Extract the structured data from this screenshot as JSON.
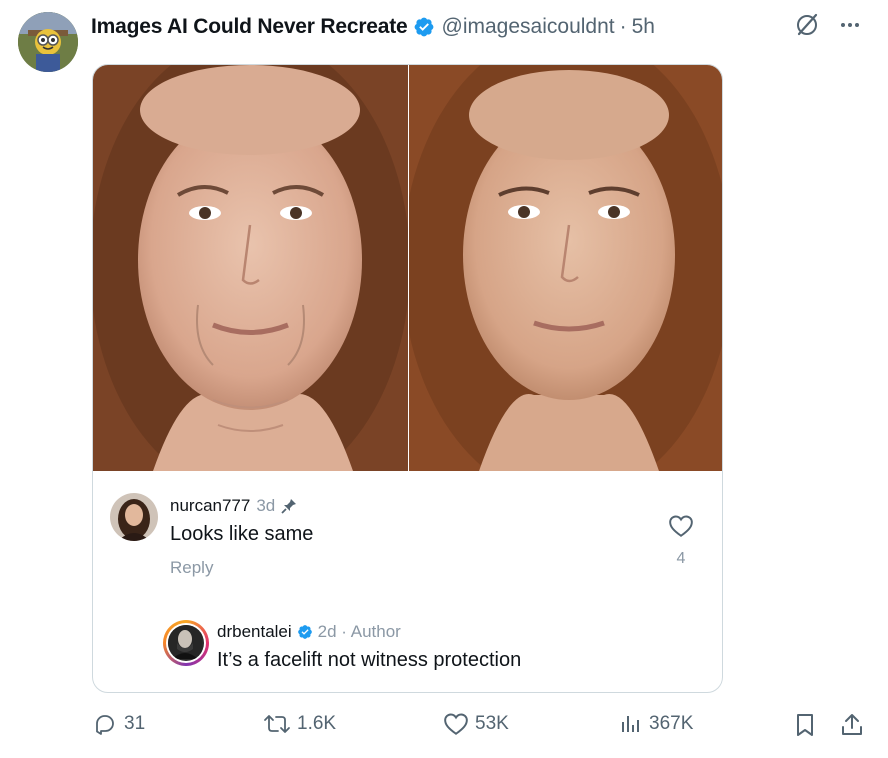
{
  "post": {
    "author_name": "Images AI Could Never Recreate",
    "handle": "@imagesaicouldnt",
    "separator": "·",
    "time": "5h"
  },
  "comment": {
    "username": "nurcan777",
    "age": "3d",
    "text": "Looks like same",
    "reply_label": "Reply",
    "like_count": "4"
  },
  "author_reply": {
    "username": "drbentalei",
    "meta": "2d · Author",
    "text": "It’s a facelift not witness protection"
  },
  "actions": {
    "replies": "31",
    "reposts": "1.6K",
    "likes": "53K",
    "views": "367K"
  },
  "icons": {
    "verified": "verified-badge-icon",
    "grok": "grok-icon",
    "more": "more-icon",
    "pin": "pin-icon",
    "heart": "heart-icon",
    "reply": "reply-icon",
    "repost": "repost-icon",
    "views": "views-icon",
    "bookmark": "bookmark-icon",
    "share": "share-icon"
  },
  "colors": {
    "verified_blue": "#1d9bf0",
    "secondary_text": "#536471",
    "comment_meta": "#8b98a5",
    "border": "#cfd9de"
  }
}
